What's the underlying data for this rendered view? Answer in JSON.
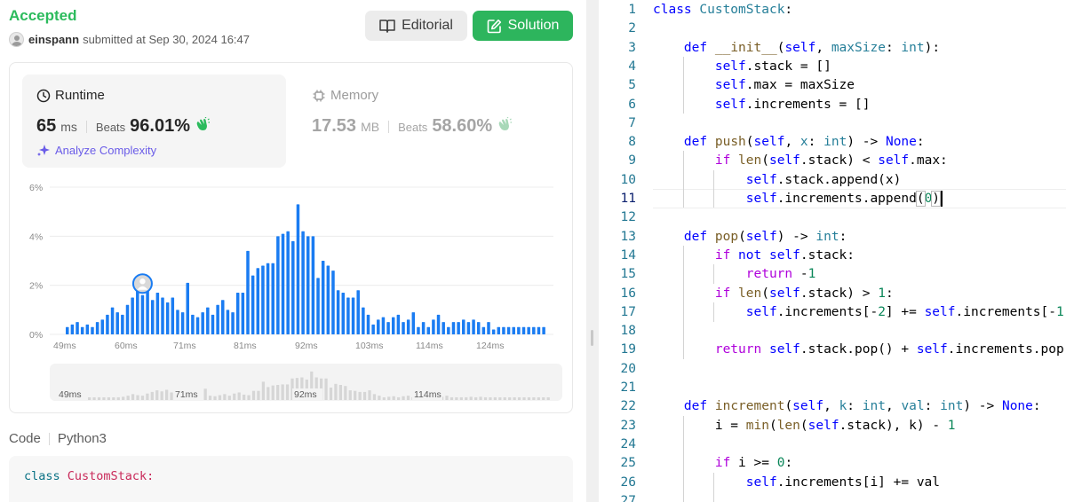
{
  "submission": {
    "status": "Accepted",
    "user": "einspann",
    "submitted_text": "submitted at Sep 30, 2024 16:47"
  },
  "buttons": {
    "editorial": "Editorial",
    "solution": "Solution"
  },
  "runtime": {
    "title": "Runtime",
    "value": "65",
    "unit": "ms",
    "beats_label": "Beats",
    "beats_value": "96.01%",
    "analyze": "Analyze Complexity"
  },
  "memory": {
    "title": "Memory",
    "value": "17.53",
    "unit": "MB",
    "beats_label": "Beats",
    "beats_value": "58.60%"
  },
  "chart_data": {
    "type": "bar",
    "y_ticks": [
      "6%",
      "4%",
      "2%",
      "0%"
    ],
    "x_ticks": [
      "49ms",
      "60ms",
      "71ms",
      "81ms",
      "92ms",
      "103ms",
      "114ms",
      "124ms"
    ],
    "mini_ticks": [
      "49ms",
      "71ms",
      "92ms",
      "114ms"
    ],
    "ylim": [
      0,
      6
    ],
    "values": [
      0.3,
      0.4,
      0.5,
      0.3,
      0.4,
      0.3,
      0.5,
      0.6,
      0.8,
      1.1,
      0.9,
      0.8,
      1.2,
      1.5,
      1.8,
      1.6,
      1.9,
      1.4,
      1.7,
      1.5,
      1.3,
      1.5,
      1.0,
      0.9,
      2.1,
      0.8,
      0.7,
      0.9,
      1.1,
      0.8,
      1.2,
      1.4,
      1.0,
      0.9,
      1.7,
      1.7,
      3.4,
      2.4,
      2.7,
      2.8,
      2.9,
      2.9,
      4.0,
      4.1,
      4.2,
      3.8,
      5.3,
      4.2,
      4.0,
      4.0,
      2.3,
      3.0,
      2.8,
      2.6,
      1.8,
      1.7,
      1.5,
      1.5,
      1.8,
      1.1,
      0.8,
      0.4,
      0.6,
      0.7,
      0.5,
      0.7,
      0.8,
      0.5,
      0.6,
      0.9,
      0.3,
      0.5,
      0.3,
      0.6,
      0.8,
      0.5,
      0.3,
      0.5,
      0.5,
      0.6,
      0.5,
      0.6,
      0.5,
      0.3,
      0.5,
      0.2,
      0.3,
      0.3,
      0.3,
      0.3,
      0.3,
      0.3,
      0.3,
      0.3,
      0.3,
      0.3
    ],
    "highlight_index": 15,
    "bar_color": "#1a7cf2",
    "mini_bar_color": "#d6d6d6"
  },
  "code_section": {
    "label": "Code",
    "language": "Python3",
    "preview_keyword": "class",
    "preview_name": "CustomStack:"
  },
  "editor": {
    "active_line": 11
  },
  "colors": {
    "accepted": "#2cbb5d",
    "solution_button": "#2db55d",
    "analyze": "#6a5ce8",
    "bar": "#1a7cf2"
  },
  "icons": {
    "editorial": "book-icon",
    "solution": "edit-square-icon",
    "runtime": "clock-icon",
    "memory": "chip-icon",
    "analyze": "sparkle-icon",
    "beats": "clap-hands-icon"
  }
}
